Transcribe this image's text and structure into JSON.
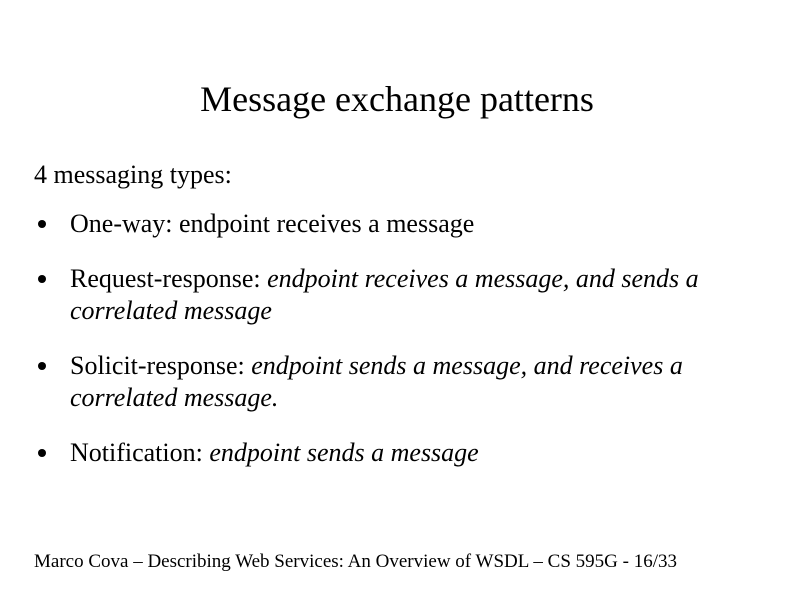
{
  "slide": {
    "title": "Message exchange patterns",
    "subtitle": "4 messaging types:",
    "bullets": [
      {
        "lead": "One-way: ",
        "rest": "endpoint receives a message",
        "rest_italic": false
      },
      {
        "lead": "Request-response: ",
        "rest": "endpoint receives a message, and sends a correlated message",
        "rest_italic": true
      },
      {
        "lead": "Solicit-response: ",
        "rest": "endpoint sends a message, and receives a correlated message.",
        "rest_italic": true
      },
      {
        "lead": "Notification: ",
        "rest": "endpoint sends a message",
        "rest_italic": true
      }
    ],
    "footer": "Marco Cova – Describing Web Services: An Overview of WSDL – CS 595G -  16/33"
  }
}
